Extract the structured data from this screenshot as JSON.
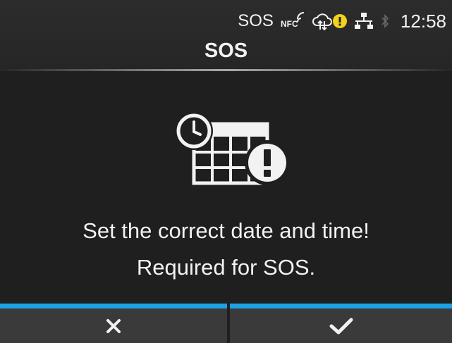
{
  "status_bar": {
    "label": "SOS",
    "nfc_label": "NFC",
    "time": "12:58",
    "icons": [
      "nfc-icon",
      "cloud-sync-icon",
      "warning-icon",
      "network-icon",
      "bluetooth-icon"
    ]
  },
  "screen": {
    "title": "SOS"
  },
  "message": {
    "line1": "Set the correct date and time!",
    "line2": "Required for SOS."
  },
  "buttons": {
    "cancel_icon": "close-icon",
    "ok_icon": "check-icon",
    "accent_color": "#1ea0e6"
  },
  "icons": {
    "main": "calendar-clock-warning-icon"
  }
}
